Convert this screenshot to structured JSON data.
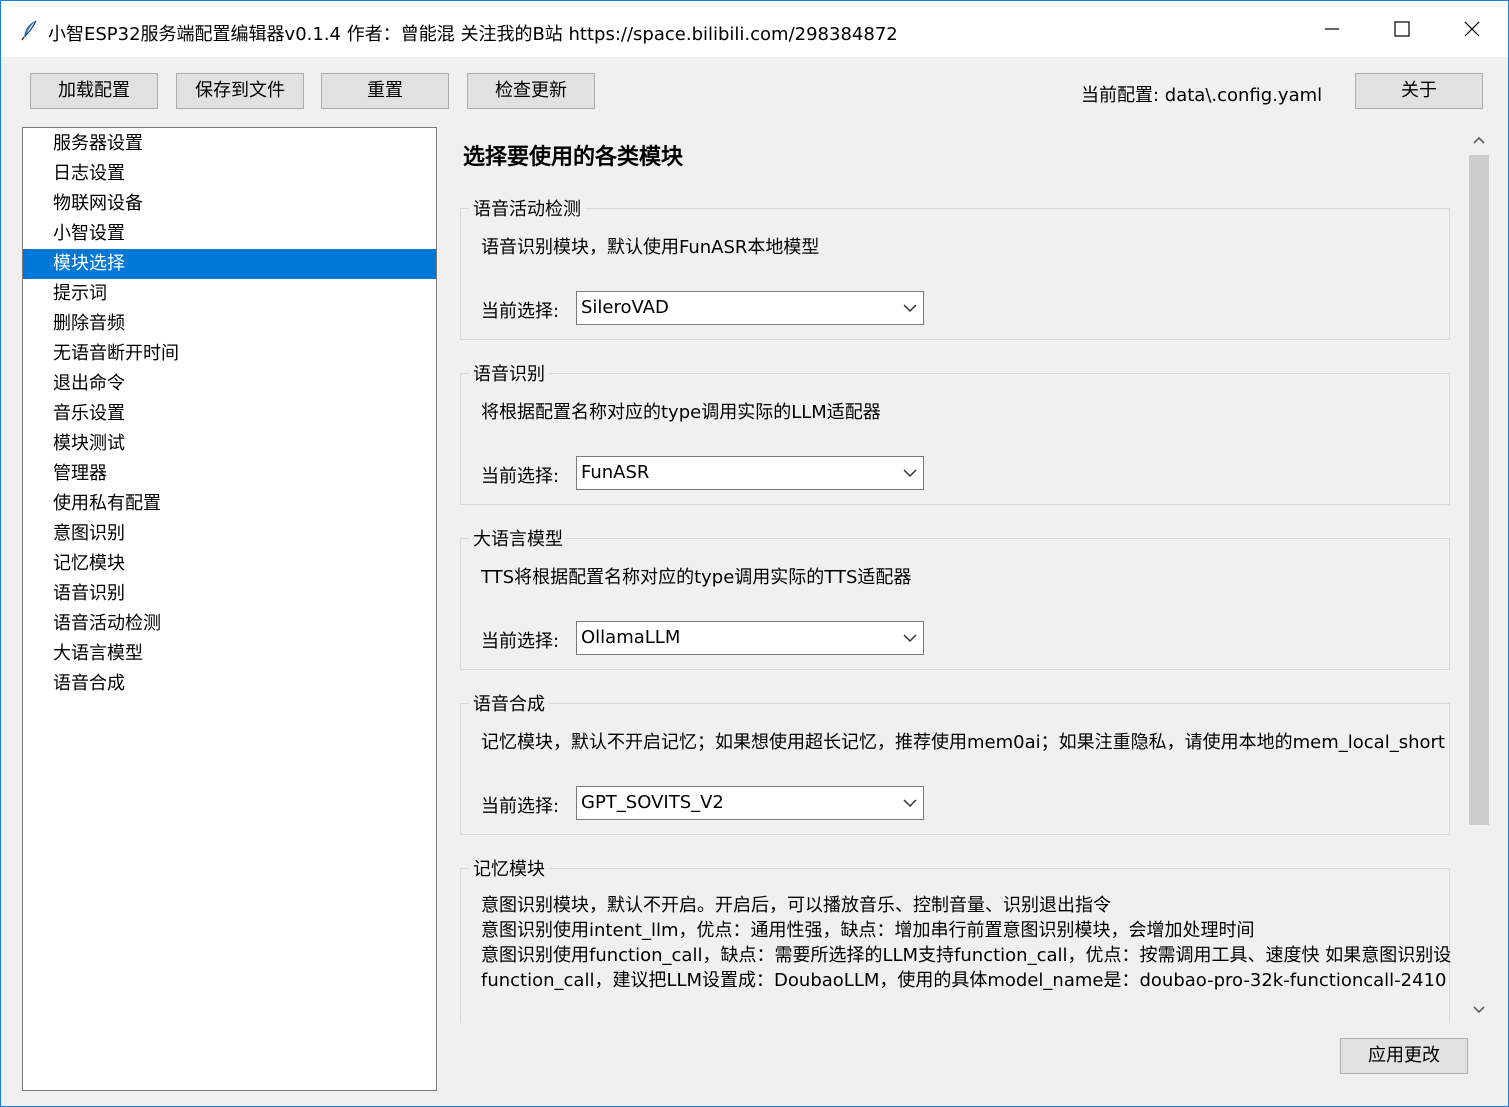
{
  "window": {
    "title": "小智ESP32服务端配置编辑器v0.1.4  作者：曾能混 关注我的B站 https://space.bilibili.com/298384872"
  },
  "toolbar": {
    "load": "加载配置",
    "save": "保存到文件",
    "reset": "重置",
    "check_update": "检查更新",
    "current_config": "当前配置: data\\.config.yaml",
    "about": "关于"
  },
  "sidebar": {
    "items": [
      {
        "label": "服务器设置"
      },
      {
        "label": "日志设置"
      },
      {
        "label": "物联网设备"
      },
      {
        "label": "小智设置"
      },
      {
        "label": "模块选择",
        "selected": true
      },
      {
        "label": "提示词"
      },
      {
        "label": "删除音频"
      },
      {
        "label": "无语音断开时间"
      },
      {
        "label": "退出命令"
      },
      {
        "label": "音乐设置"
      },
      {
        "label": "模块测试"
      },
      {
        "label": "管理器"
      },
      {
        "label": "使用私有配置"
      },
      {
        "label": "意图识别"
      },
      {
        "label": "记忆模块"
      },
      {
        "label": "语音识别"
      },
      {
        "label": "语音活动检测"
      },
      {
        "label": "大语言模型"
      },
      {
        "label": "语音合成"
      }
    ]
  },
  "main": {
    "title": "选择要使用的各类模块",
    "select_label": "当前选择:",
    "modules": [
      {
        "name": "语音活动检测",
        "desc": "语音识别模块，默认使用FunASR本地模型",
        "value": "SileroVAD"
      },
      {
        "name": "语音识别",
        "desc": "将根据配置名称对应的type调用实际的LLM适配器",
        "value": "FunASR"
      },
      {
        "name": "大语言模型",
        "desc": "TTS将根据配置名称对应的type调用实际的TTS适配器",
        "value": "OllamaLLM"
      },
      {
        "name": "语音合成",
        "desc": "记忆模块，默认不开启记忆；如果想使用超长记忆，推荐使用mem0ai；如果注重隐私，请使用本地的mem_local_short",
        "value": "GPT_SOVITS_V2"
      }
    ],
    "memory_module": {
      "name": "记忆模块",
      "desc": "意图识别模块，默认不开启。开启后，可以播放音乐、控制音量、识别退出指令\n意图识别使用intent_llm，优点：通用性强，缺点：增加串行前置意图识别模块，会增加处理时间\n意图识别使用function_call，缺点：需要所选择的LLM支持function_call，优点：按需调用工具、速度快 如果意图识别设\nfunction_call，建议把LLM设置成：DoubaoLLM，使用的具体model_name是：doubao-pro-32k-functioncall-2410"
    }
  },
  "footer": {
    "apply": "应用更改"
  },
  "colors": {
    "selection": "#0078d7",
    "window_bg": "#f0f0f0",
    "button_bg": "#e1e1e1"
  }
}
